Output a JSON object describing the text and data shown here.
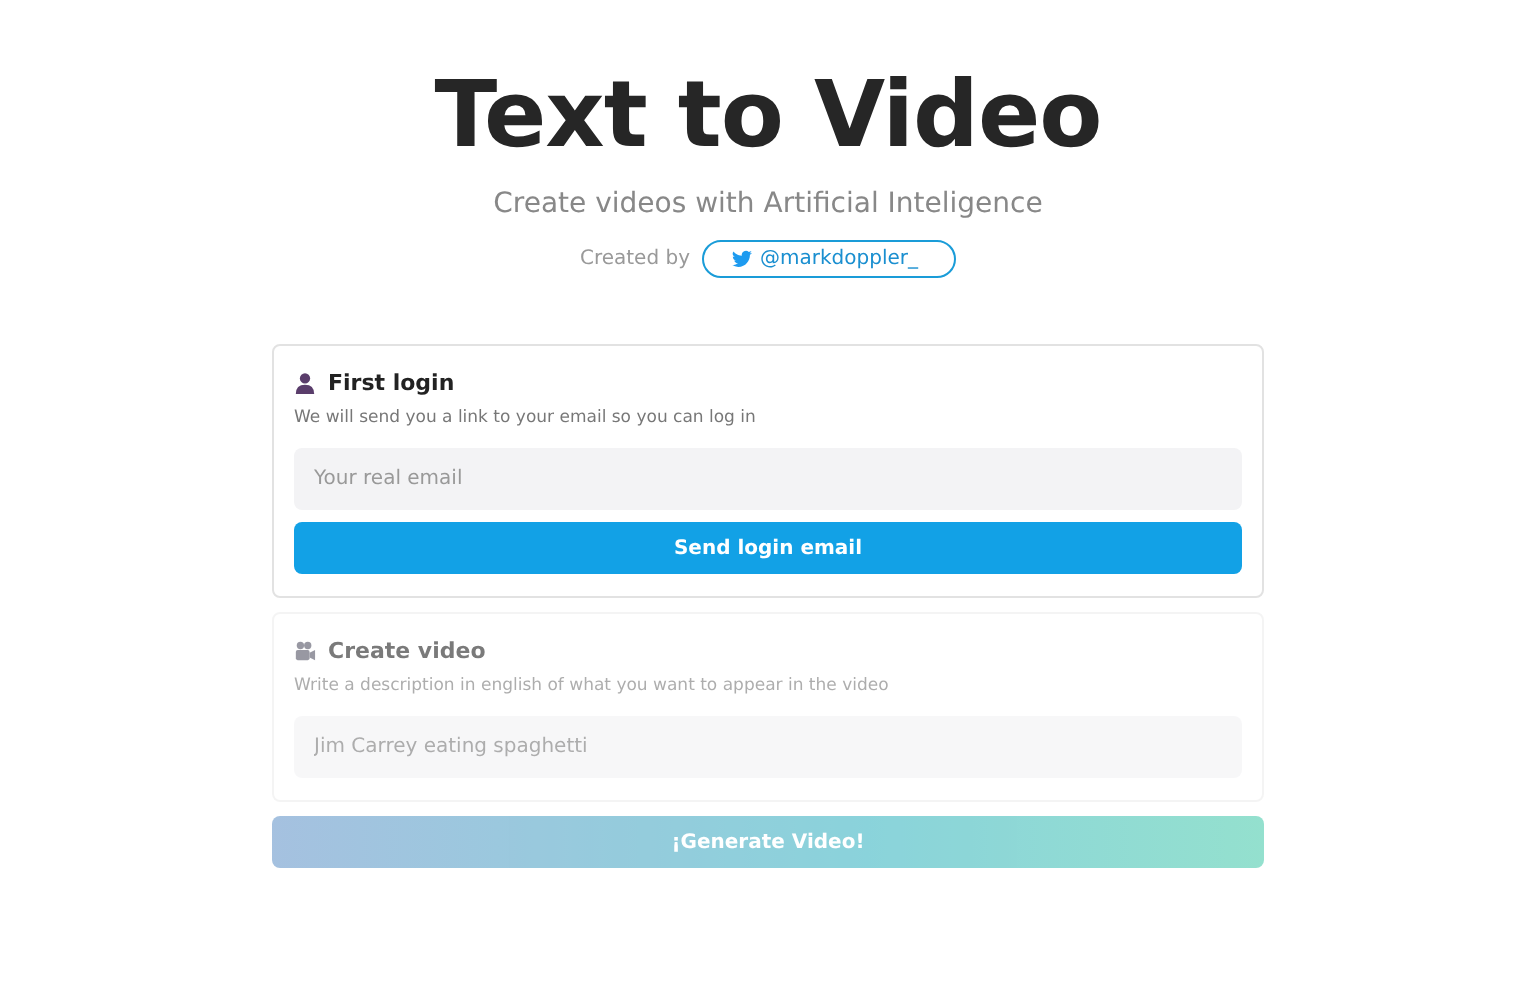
{
  "header": {
    "title": "Text to Video",
    "subtitle": "Create videos with Artificial Inteligence",
    "credit_label": "Created by",
    "credit_link": "@markdoppler_"
  },
  "sections": [
    {
      "kind": "login",
      "title": "First login",
      "description": "We will send you a link to your email so you can log in",
      "field": {
        "placeholder": "Your real email"
      },
      "button": "Send login email",
      "disabled": false
    },
    {
      "kind": "video",
      "title": "Create video",
      "description": "Write a description in english of what you want to appear in the video",
      "field": {
        "placeholder": "Jim Carrey eating spaghetti"
      },
      "disabled": true
    }
  ],
  "generate_button": {
    "label": "¡Generate Video!",
    "disabled": true
  }
}
